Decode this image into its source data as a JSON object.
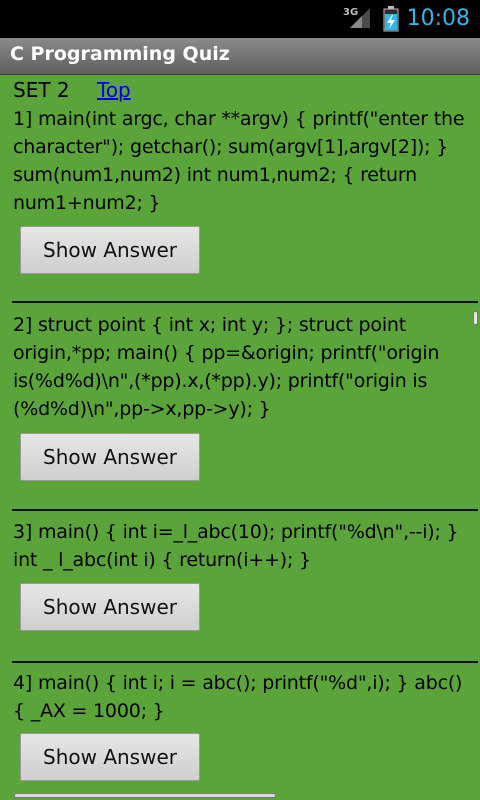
{
  "status_bar": {
    "network": "3G",
    "time": "10:08",
    "signal_icon": "signal-icon",
    "battery_icon": "battery-charging-icon",
    "clock_color": "#33b5e5"
  },
  "app": {
    "title": "C Programming Quiz",
    "background_color": "#5aa43a"
  },
  "content": {
    "set_label": "SET 2",
    "top_link": "Top",
    "button_label": "Show Answer",
    "separator": "_______________________________________________",
    "questions": [
      {
        "text": "1] main(int argc, char **argv) { printf(\"enter the character\"); getchar(); sum(argv[1],argv[2]); } sum(num1,num2) int num1,num2; { return num1+num2; }"
      },
      {
        "text": "2] struct point { int x; int y; }; struct point origin,*pp; main() { pp=&origin; printf(\"origin is(%d%d)\\n\",(*pp).x,(*pp).y); printf(\"origin is (%d%d)\\n\",pp->x,pp->y); }"
      },
      {
        "text": "3] main() { int i=_l_abc(10); printf(\"%d\\n\",--i); } int _ l_abc(int i) { return(i++); }"
      },
      {
        "text": "4] main() { int i; i = abc(); printf(\"%d\",i); } abc() { _AX = 1000; }"
      }
    ]
  }
}
